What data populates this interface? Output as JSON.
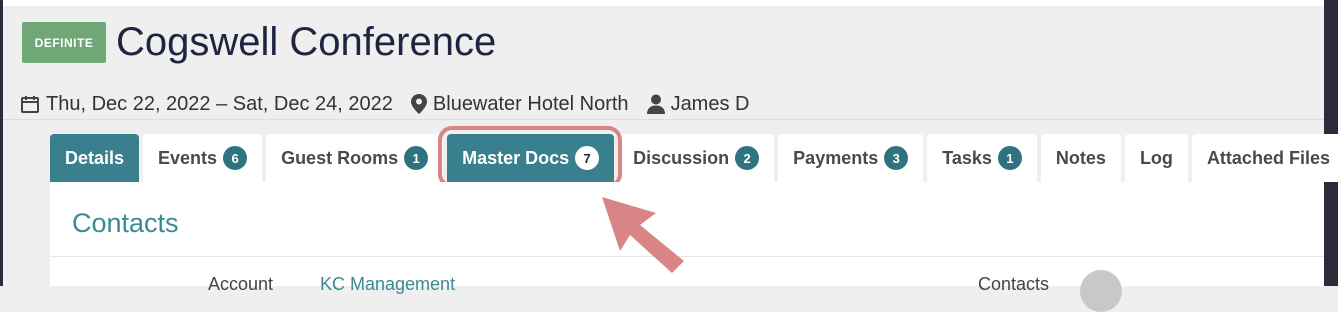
{
  "status_badge": "DEFINITE",
  "title": "Cogswell Conference",
  "meta": {
    "dates": "Thu, Dec 22, 2022 – Sat, Dec 24, 2022",
    "location": "Bluewater Hotel North",
    "owner": "James D"
  },
  "tabs": [
    {
      "label": "Details"
    },
    {
      "label": "Events",
      "count": "6"
    },
    {
      "label": "Guest Rooms",
      "count": "1"
    },
    {
      "label": "Master Docs",
      "count": "7"
    },
    {
      "label": "Discussion",
      "count": "2"
    },
    {
      "label": "Payments",
      "count": "3"
    },
    {
      "label": "Tasks",
      "count": "1"
    },
    {
      "label": "Notes"
    },
    {
      "label": "Log"
    },
    {
      "label": "Attached Files"
    }
  ],
  "section_title": "Contacts",
  "partial_labels": {
    "account_label": "Account",
    "account_value": "KC Management",
    "contacts_label": "Contacts"
  },
  "colors": {
    "accent": "#3a7f8d",
    "badge": "#6fa876",
    "highlight": "#d98585"
  },
  "icons": {
    "dates": "calendar-icon",
    "location": "map-pin-icon",
    "owner": "user-icon"
  }
}
